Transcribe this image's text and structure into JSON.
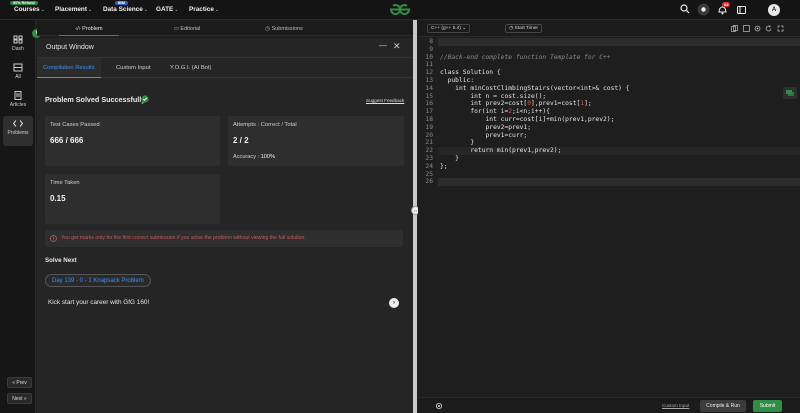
{
  "topnav": {
    "refund_badge": "90% Refund",
    "ibm_badge": "IBM",
    "items": [
      {
        "label": "Courses"
      },
      {
        "label": "Placement"
      },
      {
        "label": "Data Science"
      },
      {
        "label": "GATE"
      },
      {
        "label": "Practice"
      }
    ],
    "notification_count": "64",
    "avatar_letter": "A"
  },
  "sidebar": {
    "items": [
      {
        "label": "Dash"
      },
      {
        "label": "All"
      },
      {
        "label": "Articles"
      },
      {
        "label": "Problems"
      }
    ],
    "prev_label": "« Prev",
    "next_label": "Next »"
  },
  "problem_tabs": [
    {
      "label": "Problem"
    },
    {
      "label": "Editorial"
    },
    {
      "label": "Submissions"
    }
  ],
  "output_window": {
    "title": "Output Window",
    "tabs": [
      {
        "label": "Compilation Results"
      },
      {
        "label": "Custom Input"
      },
      {
        "label": "Y.O.G.I. (AI Bot)"
      }
    ],
    "result_title": "Problem Solved Successfully",
    "suggest_feedback": "Suggest Feedback",
    "test_cases_label": "Test Cases Passed",
    "test_cases_value": "666 / 666",
    "attempts_label": "Attempts : Correct / Total",
    "attempts_value": "2 / 2",
    "accuracy_label": "Accuracy :",
    "accuracy_value": "100%",
    "time_label": "Time Taken",
    "time_value": "0.15",
    "warning": "You get marks only for the first correct submission if you solve the problem without viewing the full solution.",
    "solve_next": "Solve Next",
    "next_problem": "Day 139 - 0 - 1 Knapsack Problem",
    "kickstart": "Kick start your career with GfG 160!"
  },
  "editor": {
    "language": "C++ (g++ 5.4)",
    "timer": "Start Timer",
    "line_numbers": [
      "8",
      "9",
      "10",
      "11",
      "12",
      "13",
      "14",
      "15",
      "16",
      "17",
      "18",
      "19",
      "20",
      "21",
      "22",
      "23",
      "24",
      "25",
      "26"
    ],
    "custom_input_link": "Custom Input",
    "compile_label": "Compile & Run",
    "submit_label": "Submit"
  },
  "colors": {
    "brand_green": "#2f8d46",
    "accent_blue": "#3f8ef0",
    "warning_red": "#c65a5a"
  }
}
